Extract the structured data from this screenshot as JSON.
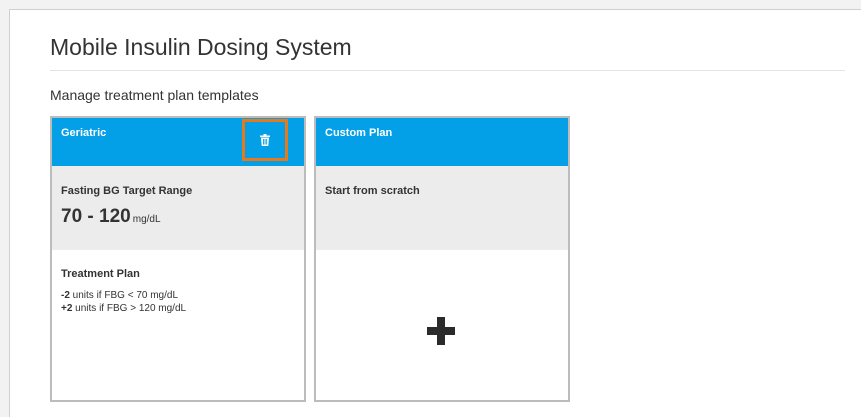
{
  "app": {
    "title": "Mobile Insulin Dosing System"
  },
  "page": {
    "subtitle": "Manage treatment plan templates"
  },
  "cards": {
    "geriatric": {
      "title": "Geriatric",
      "delete_icon": "trash-icon",
      "range_label": "Fasting BG Target Range",
      "range_value": "70 - 120",
      "range_unit": "mg/dL",
      "plan_label": "Treatment Plan",
      "plan_lines": [
        {
          "amount": "-2",
          "text": " units if FBG < 70 mg/dL"
        },
        {
          "amount": "+2",
          "text": " units if FBG > 120 mg/dL"
        }
      ]
    },
    "custom": {
      "title": "Custom Plan",
      "description": "Start from scratch",
      "add_icon": "plus-icon"
    }
  },
  "colors": {
    "header_blue": "#03a0e7",
    "highlight_orange": "#e8791a",
    "mid_gray": "#ececec",
    "plus_dark": "#2b2b2b"
  }
}
